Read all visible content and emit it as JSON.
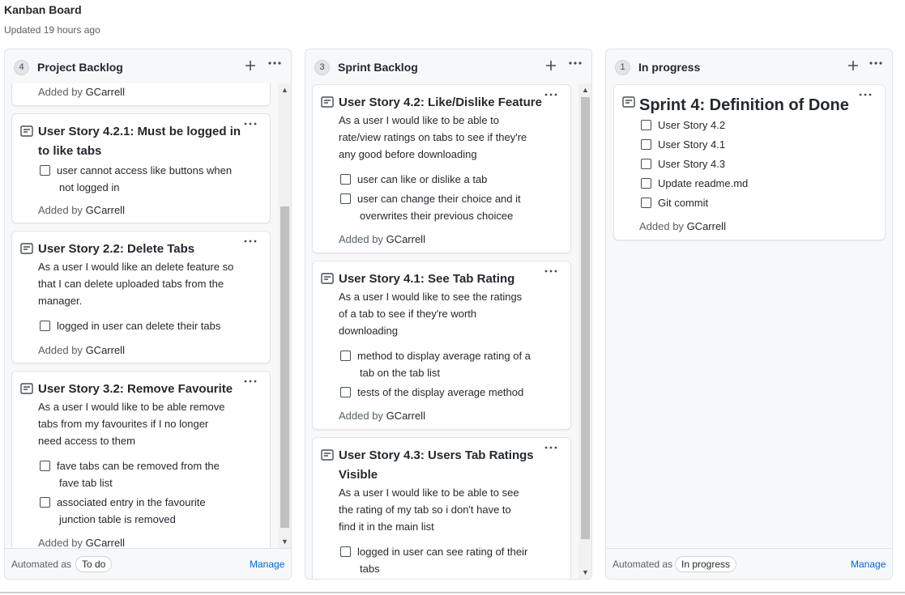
{
  "board": {
    "title": "Kanban Board",
    "updated": "Updated 19 hours ago"
  },
  "icons": {
    "add": "plus-icon",
    "more": "kebab-icon",
    "note": "note-icon",
    "task": "checkbox-icon"
  },
  "columns": [
    {
      "name": "Project Backlog",
      "count": "4",
      "automated_label": "Automated as",
      "automation": "To do",
      "manage": "Manage",
      "cards": [
        {
          "added_prefix": "Added by",
          "added_user": "GCarrell"
        },
        {
          "title_line1": "User Story 4.2.1: Must be logged in",
          "title_line2": "to like tabs",
          "tasks": [
            {
              "line1": "user cannot access like buttons when",
              "line2": "not logged in"
            }
          ],
          "added_prefix": "Added by",
          "added_user": "GCarrell"
        },
        {
          "title_line1": "User Story 2.2: Delete Tabs",
          "desc": [
            "As a user I would like an delete feature so",
            "that I can delete uploaded tabs from the",
            "manager."
          ],
          "tasks": [
            {
              "line1": "logged in user can delete their tabs"
            }
          ],
          "added_prefix": "Added by",
          "added_user": "GCarrell"
        },
        {
          "title_line1": "User Story 3.2: Remove Favourite",
          "desc": [
            "As a user I would like to be able remove",
            "tabs from my favourites if I no longer",
            "need access to them"
          ],
          "tasks": [
            {
              "line1": "fave tabs can be removed from the",
              "line2": "fave tab list"
            },
            {
              "line1": "associated entry in the favourite",
              "line2": "junction table is removed"
            }
          ],
          "added_prefix": "Added by",
          "added_user": "GCarrell"
        }
      ]
    },
    {
      "name": "Sprint Backlog",
      "count": "3",
      "cards": [
        {
          "title_line1": "User Story 4.2: Like/Dislike Feature",
          "desc": [
            "As a user I would like to be able to",
            "rate/view ratings on tabs to see if they're",
            "any good before downloading"
          ],
          "tasks": [
            {
              "line1": "user can like or dislike a tab"
            },
            {
              "line1": "user can change their choice and it",
              "line2": "overwrites their previous choicee"
            }
          ],
          "added_prefix": "Added by",
          "added_user": "GCarrell"
        },
        {
          "title_line1": "User Story 4.1: See Tab Rating",
          "desc": [
            "As a user I would like to see the ratings",
            "of a tab to see if they're worth",
            "downloading"
          ],
          "tasks": [
            {
              "line1": "method to display average rating of a",
              "line2": "tab on the tab list"
            },
            {
              "line1": "tests of the display average method"
            }
          ],
          "added_prefix": "Added by",
          "added_user": "GCarrell"
        },
        {
          "title_line1": "User Story 4.3: Users Tab Ratings",
          "title_line2": "Visible",
          "desc": [
            "As a user I would like to be able to see",
            "the rating of my tab so i don't have to",
            "find it in the main list"
          ],
          "tasks": [
            {
              "line1": "logged in user can see rating of their",
              "line2": "tabs"
            }
          ]
        }
      ]
    },
    {
      "name": "In progress",
      "count": "1",
      "automated_label": "Automated as",
      "automation": "In progress",
      "manage": "Manage",
      "cards": [
        {
          "title_line1": "Sprint 4: Definition of Done",
          "tasks": [
            {
              "line1": "User Story 4.2"
            },
            {
              "line1": "User Story 4.1"
            },
            {
              "line1": "User Story 4.3"
            },
            {
              "line1": "Update readme.md"
            },
            {
              "line1": "Git commit"
            }
          ],
          "added_prefix": "Added by",
          "added_user": "GCarrell"
        }
      ]
    }
  ]
}
